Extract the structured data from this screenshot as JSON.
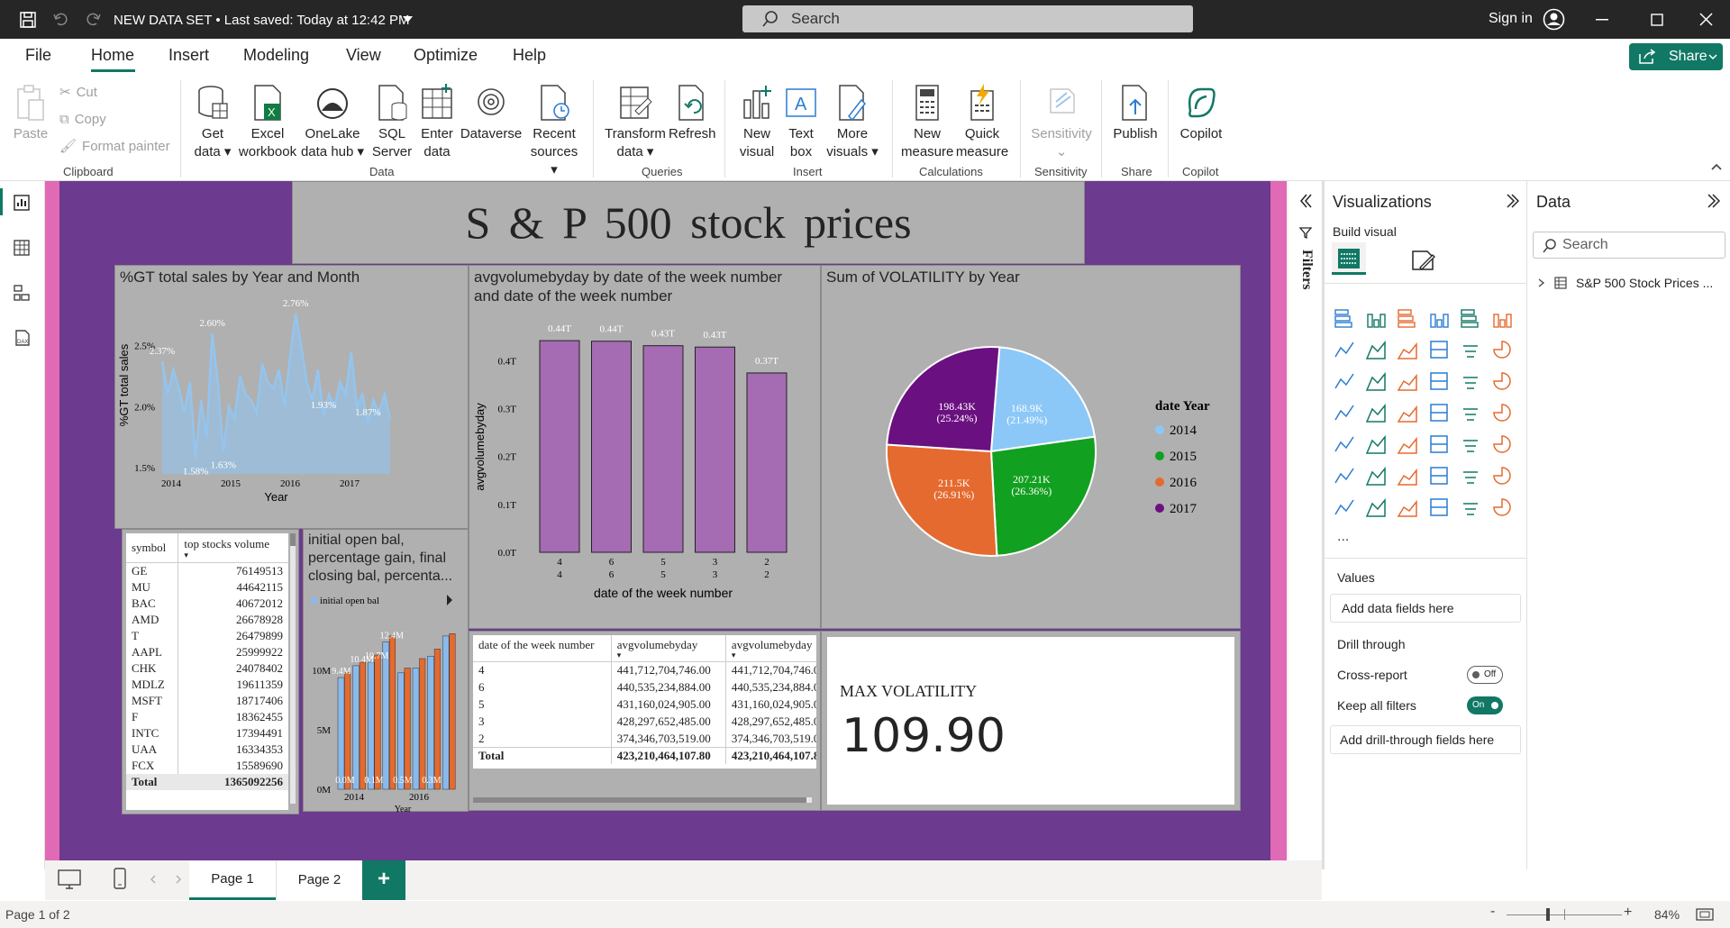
{
  "titlebar": {
    "title": "NEW DATA SET • Last saved: Today at 12:42 PM",
    "search_placeholder": "Search",
    "sign_in": "Sign in"
  },
  "menu": {
    "tabs": [
      "File",
      "Home",
      "Insert",
      "Modeling",
      "View",
      "Optimize",
      "Help"
    ],
    "active": "Home",
    "share": "Share"
  },
  "ribbon": {
    "clipboard": {
      "paste": "Paste",
      "cut": "Cut",
      "copy": "Copy",
      "format_painter": "Format painter",
      "group": "Clipboard"
    },
    "data": {
      "get_data": [
        "Get",
        "data"
      ],
      "excel": [
        "Excel",
        "workbook"
      ],
      "onelake": [
        "OneLake",
        "data hub"
      ],
      "sql": [
        "SQL",
        "Server"
      ],
      "enter": [
        "Enter",
        "data"
      ],
      "dataverse": "Dataverse",
      "recent": [
        "Recent",
        "sources"
      ],
      "group": "Data"
    },
    "queries": {
      "transform": [
        "Transform",
        "data"
      ],
      "refresh": "Refresh",
      "group": "Queries"
    },
    "insert": {
      "new_visual": [
        "New",
        "visual"
      ],
      "text_box": [
        "Text",
        "box"
      ],
      "more_visuals": [
        "More",
        "visuals"
      ],
      "group": "Insert"
    },
    "calculations": {
      "new_measure": [
        "New",
        "measure"
      ],
      "quick_measure": [
        "Quick",
        "measure"
      ],
      "group": "Calculations"
    },
    "sensitivity": {
      "label": "Sensitivity",
      "group": "Sensitivity"
    },
    "share": {
      "publish": "Publish",
      "group": "Share"
    },
    "copilot": {
      "label": "Copilot",
      "group": "Copilot"
    }
  },
  "report": {
    "title": "S & P  500  stock  prices",
    "line_visual_title": "%GT total sales by Year and Month",
    "bar_visual_title": [
      "avgvolumebyday by date of the week number",
      "and date of the week number"
    ],
    "pie_visual_title": "Sum of VOLATILITY by Year",
    "combo_visual_title": [
      "initial open bal,",
      "percentage gain, final",
      "closing bal, percenta..."
    ],
    "card_label": "MAX VOLATILITY",
    "card_value": "109.90"
  },
  "chart_data": [
    {
      "type": "line",
      "title": "%GT total sales by Year and Month",
      "xlabel": "Year",
      "ylabel": "%GT total sales",
      "x_ticks": [
        "2014",
        "2015",
        "2016",
        "2017"
      ],
      "y_ticks": [
        "1.5%",
        "2.0%",
        "2.5%"
      ],
      "ylim": [
        1.45,
        2.9
      ],
      "values": [
        2.37,
        2.1,
        2.3,
        2.15,
        1.95,
        2.2,
        1.58,
        2.05,
        1.75,
        2.6,
        2.2,
        1.63,
        2.0,
        1.9,
        2.25,
        2.1,
        2.05,
        1.95,
        2.35,
        2.2,
        2.15,
        2.3,
        2.0,
        2.4,
        2.76,
        2.5,
        2.2,
        2.05,
        2.3,
        1.93,
        2.1,
        2.0,
        2.2,
        2.1,
        2.45,
        2.0,
        2.1,
        1.87,
        2.05,
        1.95,
        2.1,
        1.9
      ],
      "data_labels": [
        {
          "index": 0,
          "text": "2.37%"
        },
        {
          "index": 6,
          "text": "1.58%"
        },
        {
          "index": 9,
          "text": "2.60%"
        },
        {
          "index": 11,
          "text": "1.63%"
        },
        {
          "index": 24,
          "text": "2.76%"
        },
        {
          "index": 29,
          "text": "1.93%"
        },
        {
          "index": 37,
          "text": "1.87%"
        }
      ],
      "color": "#93c5ef"
    },
    {
      "type": "bar",
      "title": "avgvolumebyday by date of the week number and date of the week number",
      "xlabel": "date of the week number",
      "ylabel": "avgvolumebyday",
      "categories": [
        "4",
        "6",
        "5",
        "3",
        "2"
      ],
      "values": [
        0.4417,
        0.4405,
        0.4312,
        0.4283,
        0.3743
      ],
      "data_labels": [
        "0.44T",
        "0.44T",
        "0.43T",
        "0.43T",
        "0.37T"
      ],
      "y_ticks": [
        "0.0T",
        "0.1T",
        "0.2T",
        "0.3T",
        "0.4T"
      ],
      "ylim": [
        0,
        0.44
      ],
      "color": "#a56bb3"
    },
    {
      "type": "pie",
      "title": "Sum of VOLATILITY by Year",
      "legend_title": "date Year",
      "categories": [
        "2014",
        "2015",
        "2016",
        "2017"
      ],
      "values": [
        168.9,
        207.21,
        211.5,
        198.43
      ],
      "labels": [
        [
          "168.9K",
          "(21.49%)"
        ],
        [
          "207.21K",
          "(26.36%)"
        ],
        [
          "211.5K",
          "(26.91%)"
        ],
        [
          "198.43K",
          "(25.24%)"
        ]
      ],
      "colors": [
        "#8cc8f7",
        "#12a020",
        "#e56a2f",
        "#6b1080"
      ]
    },
    {
      "type": "bar",
      "title": "initial open bal, percentage gain, final closing bal, percenta...",
      "legend": [
        "initial open bal"
      ],
      "xlabel": "Year",
      "x_ticks": [
        "2014",
        "2016"
      ],
      "y_ticks": [
        "0M",
        "5M",
        "10M"
      ],
      "ylim": [
        0,
        13.5
      ],
      "series": [
        {
          "name": "initial open bal",
          "values": [
            9.4,
            10.4,
            10.7,
            12.4,
            9.8,
            10.2,
            11.2,
            12.9
          ],
          "color": "#8ab9ec"
        },
        {
          "values": [
            9.8,
            10.7,
            11.3,
            12.9,
            10.2,
            11.0,
            11.8,
            13.1
          ],
          "color": "#e56a2f"
        }
      ],
      "data_labels": [
        "9.4M",
        "10.4M",
        "10.7M",
        "12.4M",
        "0.0M",
        "0.1M",
        "0.5M",
        "0.3M"
      ]
    }
  ],
  "stocks_table": {
    "headers": [
      "symbol",
      "top stocks volume"
    ],
    "rows": [
      [
        "GE",
        "76149513"
      ],
      [
        "MU",
        "44642115"
      ],
      [
        "BAC",
        "40672012"
      ],
      [
        "AMD",
        "26678928"
      ],
      [
        "T",
        "26479899"
      ],
      [
        "AAPL",
        "25999922"
      ],
      [
        "CHK",
        "24078402"
      ],
      [
        "MDLZ",
        "19611359"
      ],
      [
        "MSFT",
        "18717406"
      ],
      [
        "F",
        "18362455"
      ],
      [
        "INTC",
        "17394491"
      ],
      [
        "UAA",
        "16334353"
      ],
      [
        "FCX",
        "15589690"
      ]
    ],
    "total": [
      "Total",
      "1365092256"
    ]
  },
  "week_table": {
    "headers": [
      "date of the week number",
      "avgvolumebyday",
      "avgvolumebyday"
    ],
    "rows": [
      [
        "4",
        "441,712,704,746.00",
        "441,712,704,746.0"
      ],
      [
        "6",
        "440,535,234,884.00",
        "440,535,234,884.0"
      ],
      [
        "5",
        "431,160,024,905.00",
        "431,160,024,905.0"
      ],
      [
        "3",
        "428,297,652,485.00",
        "428,297,652,485.0"
      ],
      [
        "2",
        "374,346,703,519.00",
        "374,346,703,519.0"
      ]
    ],
    "total": [
      "Total",
      "423,210,464,107.80",
      "423,210,464,107.8"
    ]
  },
  "filters_label": "Filters",
  "viz_pane": {
    "title": "Visualizations",
    "build_visual": "Build visual",
    "values": "Values",
    "add_fields": "Add data fields here",
    "drill_through": "Drill through",
    "cross_report": "Cross-report",
    "cross_report_state": "Off",
    "keep_filters": "Keep all filters",
    "keep_filters_state": "On",
    "add_drill": "Add drill-through fields here",
    "more": "..."
  },
  "data_pane": {
    "title": "Data",
    "search_placeholder": "Search",
    "table_name": "S&P 500 Stock Prices ..."
  },
  "page_tabs": [
    "Page 1",
    "Page 2"
  ],
  "add_page": "+",
  "status": {
    "page": "Page 1 of 2",
    "zoom": "84%"
  }
}
